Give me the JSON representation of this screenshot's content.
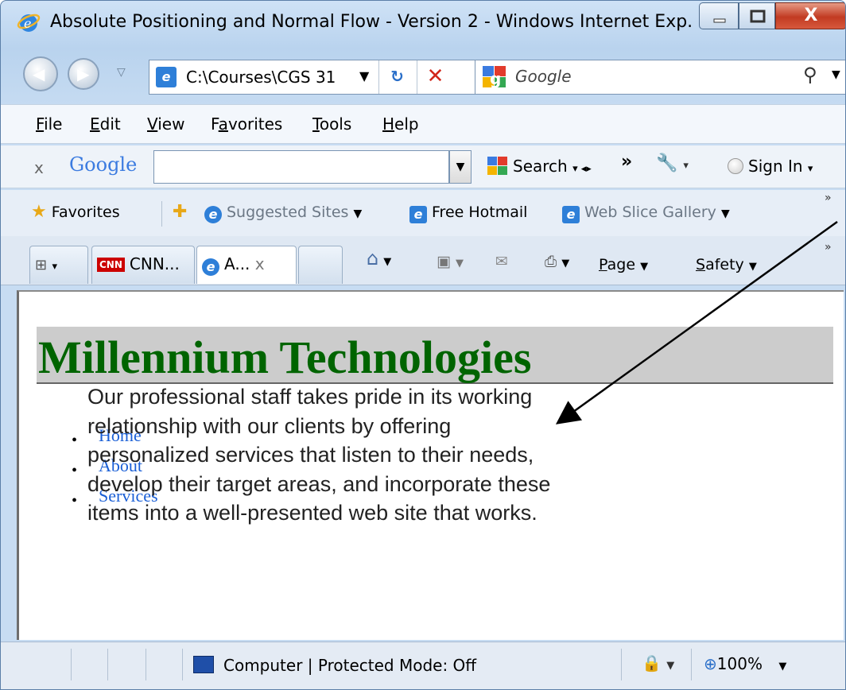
{
  "window": {
    "title": "Absolute Positioning and Normal Flow - Version 2 - Windows Internet Exp...",
    "close_glyph": "X"
  },
  "nav": {
    "address": "C:\\Courses\\CGS 31",
    "search_placeholder": "Google"
  },
  "menu": {
    "items": [
      {
        "accel": "F",
        "rest": "ile"
      },
      {
        "accel": "E",
        "rest": "dit"
      },
      {
        "accel": "V",
        "rest": "iew"
      },
      {
        "pre": "F",
        "accel": "a",
        "rest": "vorites"
      },
      {
        "accel": "T",
        "rest": "ools"
      },
      {
        "accel": "H",
        "rest": "elp"
      }
    ]
  },
  "google_toolbar": {
    "close": "x",
    "logo": "Google",
    "search_label": "Search",
    "sign_in": "Sign In"
  },
  "favorites_bar": {
    "favorites": "Favorites",
    "suggested_sites": "Suggested Sites",
    "free_hotmail": "Free Hotmail",
    "web_slice_gallery": "Web Slice Gallery"
  },
  "tabs": [
    {
      "label": "CNN...",
      "logo": "CNN"
    },
    {
      "label": "A...",
      "close": "x"
    }
  ],
  "command_bar": {
    "page": {
      "accel": "P",
      "rest": "age"
    },
    "safety": {
      "accel": "S",
      "rest": "afety"
    }
  },
  "page": {
    "heading": "Millennium Technologies",
    "nav_links": [
      "Home",
      "About",
      "Services"
    ],
    "body": "Our professional staff takes pride in its working relationship with our clients by offering personalized services that listen to their needs, develop their target areas, and incorporate these items into a well-presented web site that works.",
    "heading_color": "#006400",
    "link_color": "#1a5fd6",
    "band_color": "#cccccc"
  },
  "status": {
    "zone": "Computer | Protected Mode: Off",
    "zoom": "100%"
  }
}
